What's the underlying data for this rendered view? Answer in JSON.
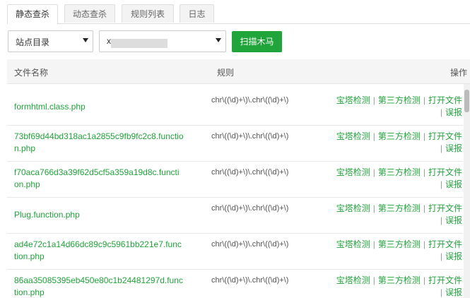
{
  "tabs": [
    "静态查杀",
    "动态查杀",
    "规则列表",
    "日志"
  ],
  "site_select": {
    "value": "站点目录"
  },
  "path_select": {
    "value": "x"
  },
  "scan_button": "扫描木马",
  "table": {
    "headers": {
      "file": "文件名称",
      "rule": "规则",
      "ops": "操作"
    },
    "rows": [
      {
        "file": "formhtml.class.php",
        "rule": "chr\\((\\d)+\\)\\.chr\\((\\d)+\\)"
      },
      {
        "file": "73bf69d44bd318ac1a2855c9fb9fc2c8.function.php",
        "rule": "chr\\((\\d)+\\)\\.chr\\((\\d)+\\)"
      },
      {
        "file": "f70aca766d3a39f62d5cf5a359a19d8c.function.php",
        "rule": "chr\\((\\d)+\\)\\.chr\\((\\d)+\\)"
      },
      {
        "file": "Plug.function.php",
        "rule": "chr\\((\\d)+\\)\\.chr\\((\\d)+\\)"
      },
      {
        "file": "ad4e72c1a14d66dc89c9c5961bb221e7.function.php",
        "rule": "chr\\((\\d)+\\)\\.chr\\((\\d)+\\)"
      },
      {
        "file": "86aa35085395eb450e80c1b24481297d.function.php",
        "rule": "chr\\((\\d)+\\)\\.chr\\((\\d)+\\)"
      }
    ],
    "actions": {
      "bt_check": "宝塔检测",
      "third_check": "第三方检测",
      "open_file": "打开文件",
      "false_report": "误报",
      "separator": "|"
    }
  },
  "colors": {
    "accent": "#20a53a",
    "header_bg": "#f5f5f5",
    "tab_bg": "#f3f3f3"
  }
}
